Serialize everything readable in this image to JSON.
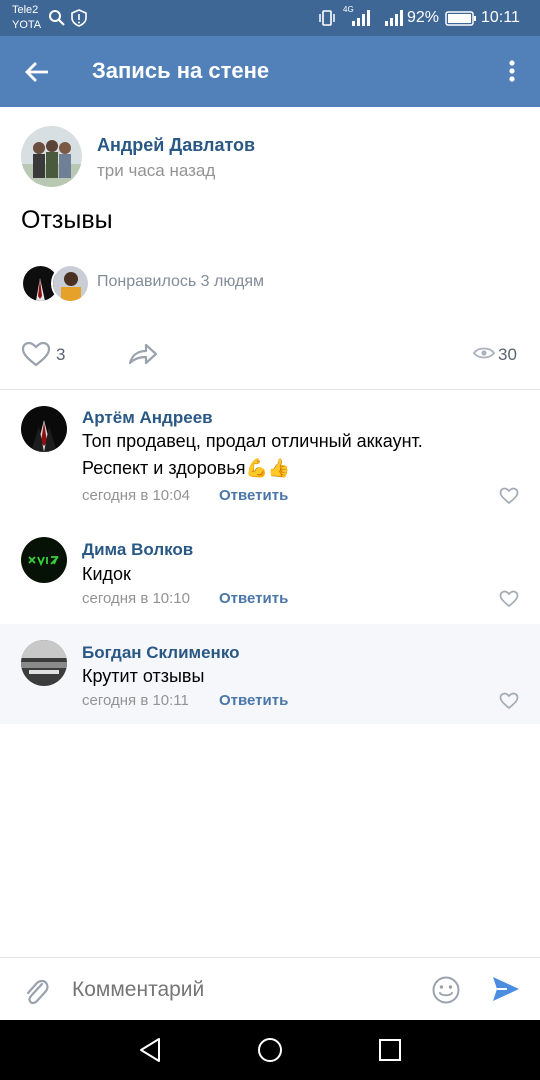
{
  "status_bar": {
    "carrier_1": "Tele2",
    "carrier_2": "YOTA",
    "network": "4G",
    "battery": "92%",
    "time": "10:11"
  },
  "app_bar": {
    "title": "Запись на стене",
    "back_icon": "arrow-left-icon",
    "menu_icon": "more-vertical-icon"
  },
  "post": {
    "author": "Андрей Давлатов",
    "time": "три часа назад",
    "text": "Отзывы",
    "liked_by": "Понравилось 3 людям",
    "likes_count": "3",
    "views_count": "30"
  },
  "comments": [
    {
      "author": "Артём Андреев",
      "text_line1": "Топ продавец, продал отличный аккаунт.",
      "text_line2": "Респект и здоровья",
      "emoji": "💪👍",
      "time": "сегодня в 10:04",
      "reply": "Ответить"
    },
    {
      "author": "Дима Волков",
      "text_line1": "Кидок",
      "time": "сегодня в 10:10",
      "reply": "Ответить"
    },
    {
      "author": "Богдан Склименко",
      "text_line1": "Крутит отзывы",
      "time": "сегодня в 10:11",
      "reply": "Ответить"
    }
  ],
  "input": {
    "placeholder": "Комментарий"
  },
  "colors": {
    "status_bar": "#3f6796",
    "app_bar": "#5181b8",
    "name": "#2a5885",
    "accent": "#4a76a8"
  }
}
